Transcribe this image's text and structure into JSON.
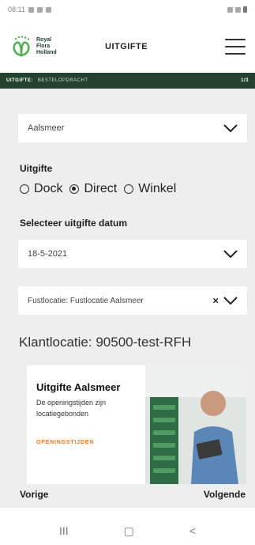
{
  "status": {
    "time": "08:11",
    "signal": "📶"
  },
  "header": {
    "brand_line1": "Royal",
    "brand_line2": "Flora",
    "brand_line3": "Holland",
    "title": "UITGIFTE",
    "brand_color": "#23432e",
    "logo_color": "#4caf50"
  },
  "breadcrumb": {
    "section": "UITGIFTE:",
    "step": "BESTELOPDRACHT",
    "page": "1/3"
  },
  "form": {
    "location_value": "Aalsmeer",
    "uitgifte_label": "Uitgifte",
    "options": [
      {
        "label": "Dock",
        "selected": false
      },
      {
        "label": "Direct",
        "selected": true
      },
      {
        "label": "Winkel",
        "selected": false
      }
    ],
    "date_label": "Selecteer uitgifte datum",
    "date_value": "18-5-2021",
    "fust_value": "Fustlocatie: Fustlocatie Aalsmeer",
    "clear_symbol": "×",
    "klant": "Klantlocatie: 90500-test-RFH"
  },
  "promo": {
    "title": "Uitgifte Aalsmeer",
    "text": "De openingstijden zijn locatiegebonden",
    "link": "OPENINGSTIJDEN",
    "link_color": "#e87722"
  },
  "nav": {
    "prev": "Vorige",
    "next": "Volgende"
  },
  "system_nav": {
    "recents": "III",
    "home": "▢",
    "back": "<"
  }
}
